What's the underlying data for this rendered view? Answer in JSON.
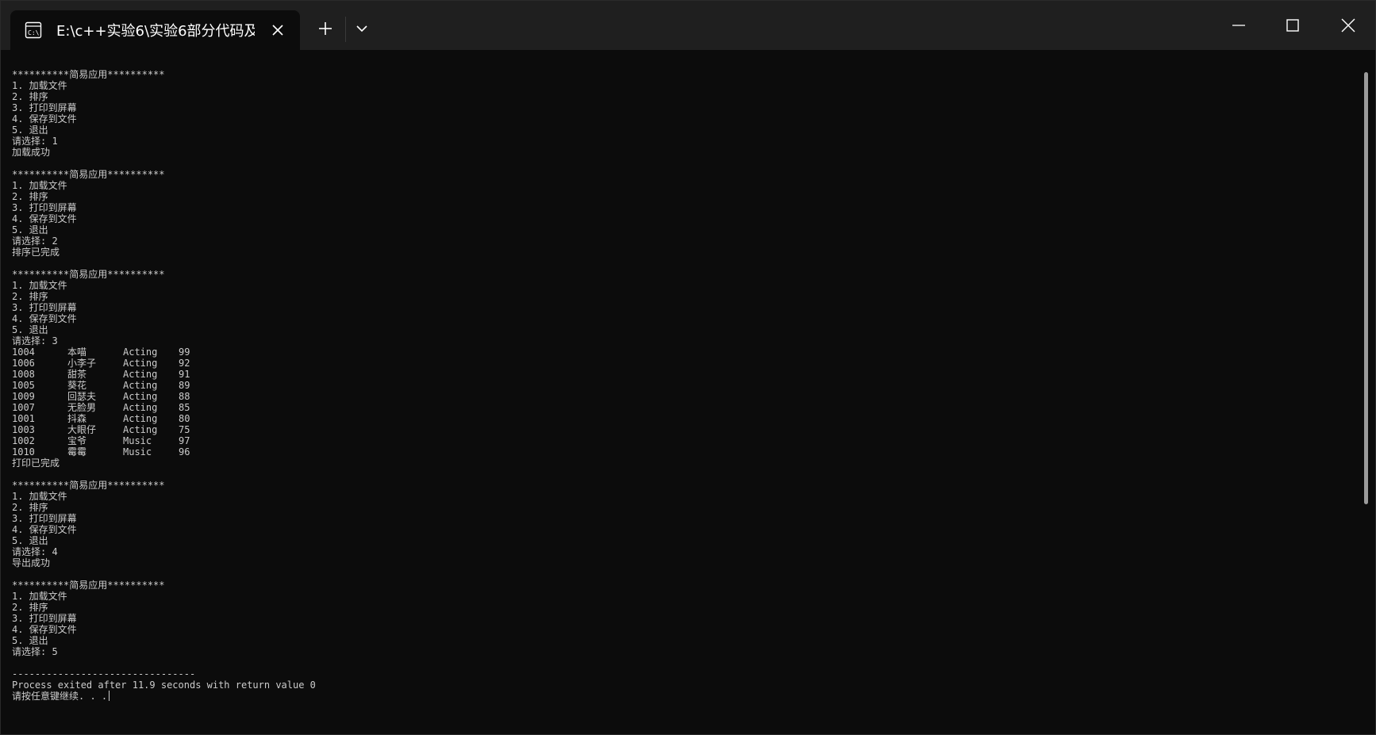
{
  "window": {
    "tab_title": "E:\\c++实验6\\实验6部分代码及",
    "tab_icon": "terminal-icon",
    "controls": {
      "new_tab": "plus-icon",
      "dropdown": "chevron-down-icon",
      "minimize": "minimize-icon",
      "maximize": "maximize-icon",
      "close": "close-icon"
    }
  },
  "console": {
    "blocks": [
      {
        "header": "**********简易应用**********",
        "menu": [
          "1. 加载文件",
          "2. 排序",
          "3. 打印到屏幕",
          "4. 保存到文件",
          "5. 退出"
        ],
        "prompt": "请选择: 1",
        "result": "加载成功"
      },
      {
        "header": "**********简易应用**********",
        "menu": [
          "1. 加载文件",
          "2. 排序",
          "3. 打印到屏幕",
          "4. 保存到文件",
          "5. 退出"
        ],
        "prompt": "请选择: 2",
        "result": "排序已完成"
      },
      {
        "header": "**********简易应用**********",
        "menu": [
          "1. 加载文件",
          "2. 排序",
          "3. 打印到屏幕",
          "4. 保存到文件",
          "5. 退出"
        ],
        "prompt": "请选择: 3",
        "table": [
          [
            "1004",
            "本喵",
            "Acting",
            "99"
          ],
          [
            "1006",
            "小李子",
            "Acting",
            "92"
          ],
          [
            "1008",
            "甜茶",
            "Acting",
            "91"
          ],
          [
            "1005",
            "葵花",
            "Acting",
            "89"
          ],
          [
            "1009",
            "回瑟夫",
            "Acting",
            "88"
          ],
          [
            "1007",
            "无脸男",
            "Acting",
            "85"
          ],
          [
            "1001",
            "抖森",
            "Acting",
            "80"
          ],
          [
            "1003",
            "大眼仔",
            "Acting",
            "75"
          ],
          [
            "1002",
            "宝爷",
            "Music",
            "97"
          ],
          [
            "1010",
            "霉霉",
            "Music",
            "96"
          ]
        ],
        "result": "打印已完成"
      },
      {
        "header": "**********简易应用**********",
        "menu": [
          "1. 加载文件",
          "2. 排序",
          "3. 打印到屏幕",
          "4. 保存到文件",
          "5. 退出"
        ],
        "prompt": "请选择: 4",
        "result": "导出成功"
      },
      {
        "header": "**********简易应用**********",
        "menu": [
          "1. 加载文件",
          "2. 排序",
          "3. 打印到屏幕",
          "4. 保存到文件",
          "5. 退出"
        ],
        "prompt": "请选择: 5"
      }
    ],
    "divider": "--------------------------------",
    "exit_message": "Process exited after 11.9 seconds with return value 0",
    "continue_prompt": "请按任意键继续. . ."
  }
}
